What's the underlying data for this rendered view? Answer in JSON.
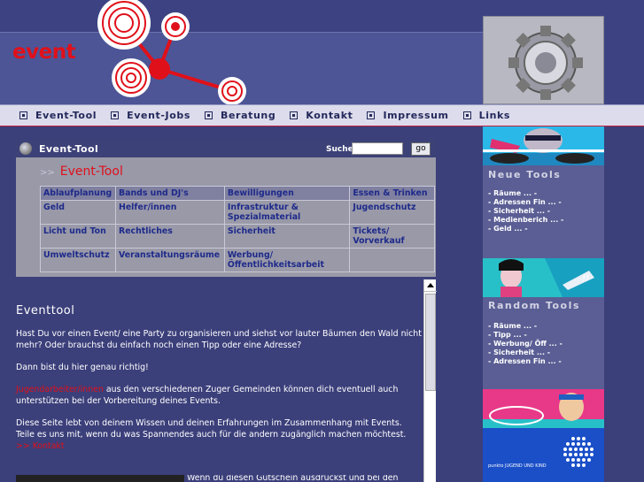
{
  "logo": {
    "text": "event"
  },
  "nav": [
    {
      "label": "Event-Tool"
    },
    {
      "label": "Event-Jobs"
    },
    {
      "label": "Beratung"
    },
    {
      "label": "Kontakt"
    },
    {
      "label": "Impressum"
    },
    {
      "label": "Links"
    }
  ],
  "panel": {
    "title": "Event-Tool",
    "search_label": "Suche",
    "search_value": "",
    "go_label": "go",
    "subtitle_arrow": ">>",
    "subtitle": "Event-Tool",
    "grid": [
      [
        "Ablaufplanung",
        "Bands und DJ's",
        "Bewilligungen",
        "Essen & Trinken"
      ],
      [
        "Geld",
        "Helfer/innen",
        "Infrastruktur & Spezialmaterial",
        "Jugendschutz"
      ],
      [
        "Licht und Ton",
        "Rechtliches",
        "Sicherheit",
        "Tickets/ Vorverkauf"
      ],
      [
        "Umweltschutz",
        "Veranstaltungsräume",
        "Werbung/ Öffentlichkeitsarbeit",
        ""
      ]
    ]
  },
  "content": {
    "title": "Eventtool",
    "p1": "Hast Du vor einen Event/ eine Party zu organisieren und siehst vor lauter Bäumen den Wald nicht mehr? Oder brauchst du einfach noch einen Tipp oder eine Adresse?",
    "p2": "Dann bist du hier genau richtig!",
    "p3_link": "Jugendarbeiter/innen",
    "p3_text": " aus den verschiedenen Zuger Gemeinden können dich eventuell auch unterstützen bei der Vorbereitung deines Events.",
    "p4_text": "Diese Seite lebt von deinem Wissen und deinen Erfahrungen im Zusammenhang mit Events. Teile es uns mit, wenn du was Spannendes auch für die andern zugänglich machen möchtest. ",
    "p4_link": ">> Kontakt",
    "p5": "Wenn du diesen Gutschein ausdruckst und bei den"
  },
  "right": {
    "neue_title": "Neue Tools",
    "neue_items": [
      "- Räume ... -",
      "- Adressen Fin ... -",
      "- Sicherheit ... -",
      "- Medienberich ... -",
      "- Geld ... -"
    ],
    "random_title": "Random Tools",
    "random_items": [
      "- Räume ... -",
      "- Tipp ... -",
      "- Werbung/ Öff ... -",
      "- Sicherheit ... -",
      "- Adressen Fin ... -"
    ],
    "banner_text": "punkto JUGEND UND KIND"
  },
  "colors": {
    "accent": "#e0101a",
    "nav_bg": "#dcdcec",
    "page_bg": "#3b3f7a"
  }
}
